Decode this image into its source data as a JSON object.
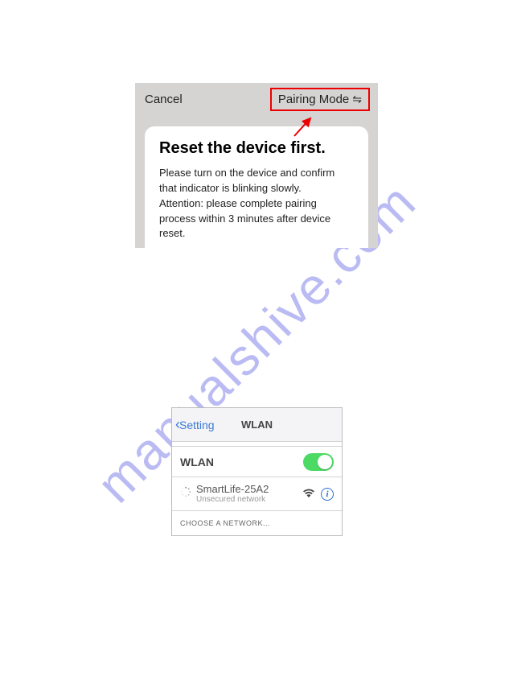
{
  "watermark": "manualshive.com",
  "pairing": {
    "cancel_label": "Cancel",
    "mode_label": "Pairing Mode",
    "title": "Reset the device first.",
    "desc_line1": "Please turn on the device and confirm that indicator is blinking slowly.",
    "desc_line2": "Attention: please complete pairing process within 3 minutes after device reset."
  },
  "wlan": {
    "back_label": "Setting",
    "title": "WLAN",
    "toggle_label": "WLAN",
    "toggle_on": true,
    "network": {
      "name": "SmartLife-25A2",
      "security": "Unsecured network"
    },
    "choose_label": "CHOOSE A NETWORK..."
  }
}
